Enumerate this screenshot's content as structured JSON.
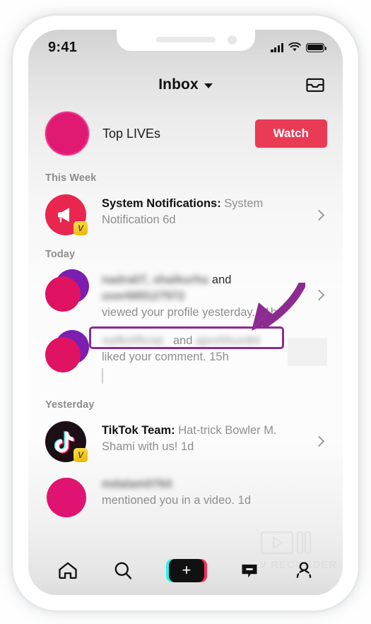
{
  "status_bar": {
    "time": "9:41",
    "signal_icon": "cellular-signal-icon",
    "wifi_icon": "wifi-icon",
    "battery_icon": "battery-icon"
  },
  "header": {
    "title": "Inbox",
    "dropdown_icon": "chevron-down-icon",
    "inbox_icon": "inbox-tray-icon"
  },
  "live": {
    "label": "Top LIVEs",
    "watch_label": "Watch",
    "avatar_name": "live-avatar"
  },
  "sections": [
    {
      "title": "This Week"
    },
    {
      "title": "Today"
    },
    {
      "title": "Yesterday"
    }
  ],
  "notifications": {
    "system": {
      "sender": "System Notifications:",
      "message": " System Notification",
      "time": "6d",
      "avatar_icon": "megaphone-icon",
      "badge": "V"
    },
    "profile_view": {
      "names_blurred_1": "nadra07, shaikurhu",
      "conjunction": " and ",
      "names_blurred_2": "user689127972",
      "action": "viewed your profile yesterday.",
      "time": "11h"
    },
    "comment_like": {
      "names_blurred_1": "nafkofficial_",
      "conjunction": " and ",
      "names_blurred_2": "ajeshhun84",
      "action": "liked your comment.",
      "time": "15h"
    },
    "tiktok_team": {
      "sender": "TikTok Team:",
      "message": " Hat-trick Bowler M. Shami with us!",
      "time": "1d",
      "avatar_icon": "tiktok-note-icon",
      "badge": "V"
    },
    "mention": {
      "name_blurred": "mdalam0764",
      "action": "mentioned you in a video.",
      "time": "1d"
    }
  },
  "annotation": {
    "highlight_color": "#8d2a91",
    "arrow_color": "#8d2a91",
    "highlighted_text": "viewed your profile yesterday. 11h"
  },
  "watermark": {
    "text": "V RECORDER",
    "icon": "video-recorder-icon"
  },
  "bottom_nav": {
    "items": [
      {
        "name": "home",
        "icon": "home-icon"
      },
      {
        "name": "discover",
        "icon": "search-icon"
      },
      {
        "name": "create",
        "icon": "plus-icon"
      },
      {
        "name": "inbox",
        "icon": "message-bubble-icon"
      },
      {
        "name": "profile",
        "icon": "person-icon"
      }
    ]
  },
  "colors": {
    "accent_pink": "#e01262",
    "accent_purple": "#7a1fb0",
    "watch_red": "#ea3b55",
    "system_red": "#e8264f",
    "badge_yellow": "#ffe14d",
    "annotation_purple": "#8d2a91"
  }
}
